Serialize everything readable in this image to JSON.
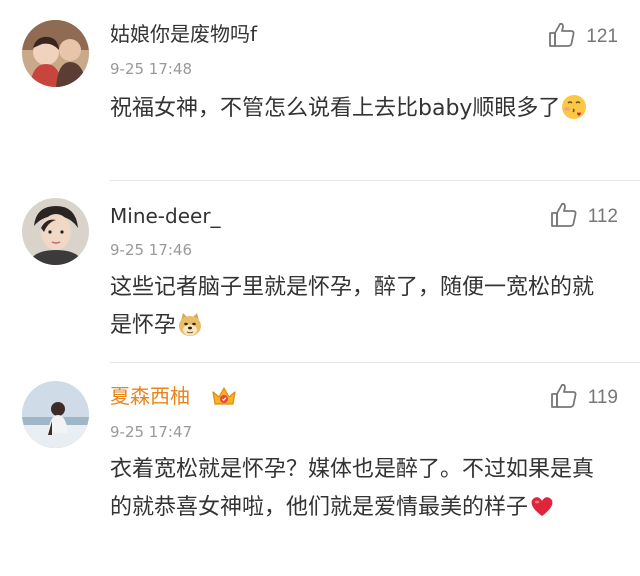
{
  "comments": [
    {
      "username": "姑娘你是废物吗f",
      "time": "9-25 17:48",
      "likes": "121",
      "text": "祝福女神，不管怎么说看上去比baby顺眼多了",
      "emoji": "kiss-emoji"
    },
    {
      "username": "Mine-deer_",
      "time": "9-25 17:46",
      "likes": "112",
      "text": "这些记者脑子里就是怀孕，醉了，随便一宽松的就是怀孕",
      "emoji": "doge-emoji"
    },
    {
      "username": "夏森西柚",
      "time": "9-25 17:47",
      "likes": "119",
      "text": "衣着宽松就是怀孕？媒体也是醉了。不过如果是真的就恭喜女神啦，他们就是爱情最美的样子",
      "emoji": "heart-emoji",
      "badge": "vip-crown-icon"
    }
  ],
  "colors": {
    "username": "#333333",
    "vip_username": "#e8851d",
    "time": "#999999",
    "like_count": "#777777",
    "divider": "#e6e6e6",
    "heart": "#e0243a"
  }
}
